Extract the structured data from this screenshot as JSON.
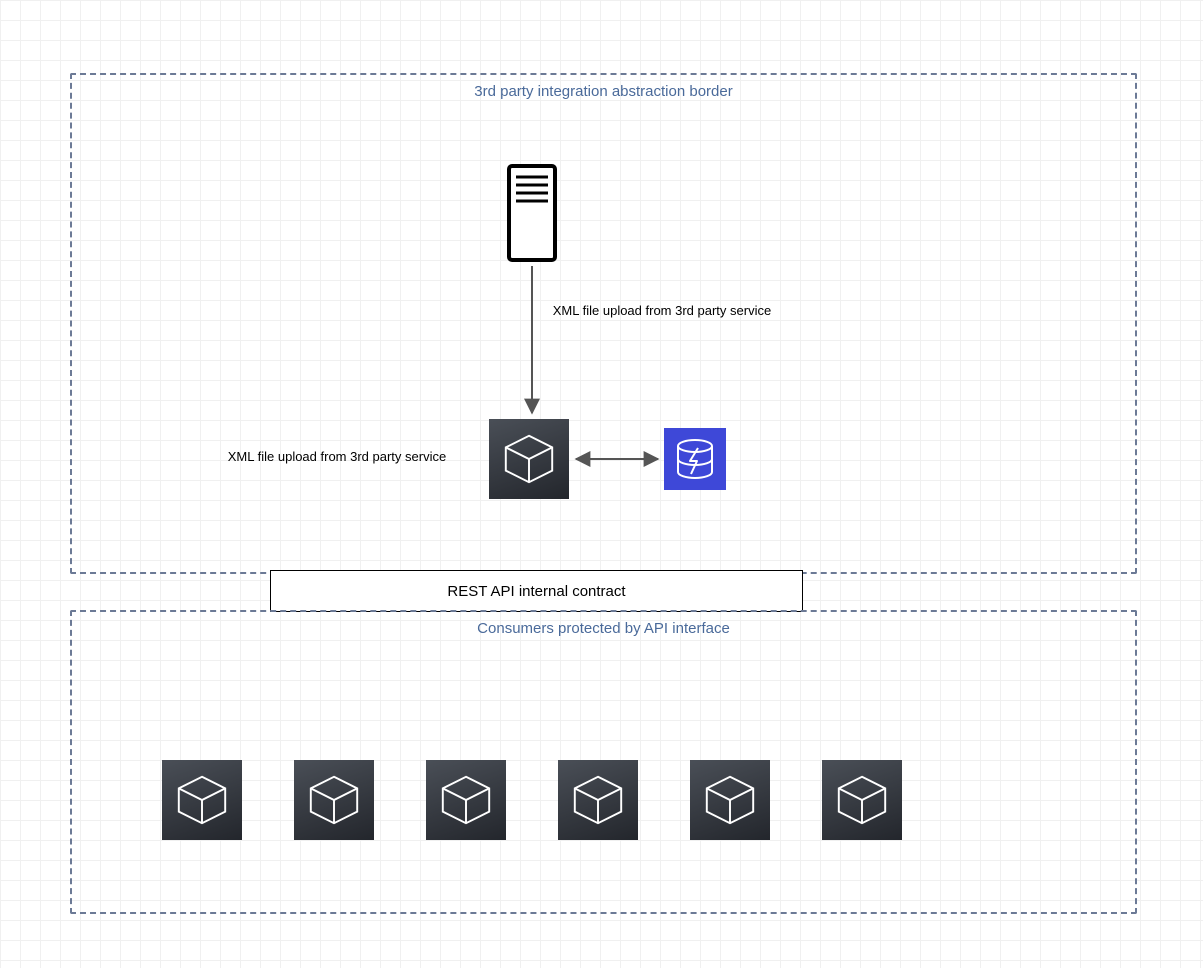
{
  "topBox": {
    "title": "3rd party integration abstraction border"
  },
  "bottomBox": {
    "title": "Consumers protected by API interface"
  },
  "middleBar": {
    "label": "REST API internal contract"
  },
  "labels": {
    "arrowDown": "XML file upload from 3rd party service",
    "leftOfCube": "XML file upload from 3rd party service"
  },
  "icons": {
    "server": "server-icon",
    "mainCube": "cube-icon",
    "db": "database-bolt-icon",
    "consumerCube": "cube-icon"
  },
  "consumers": {
    "count": 6
  }
}
